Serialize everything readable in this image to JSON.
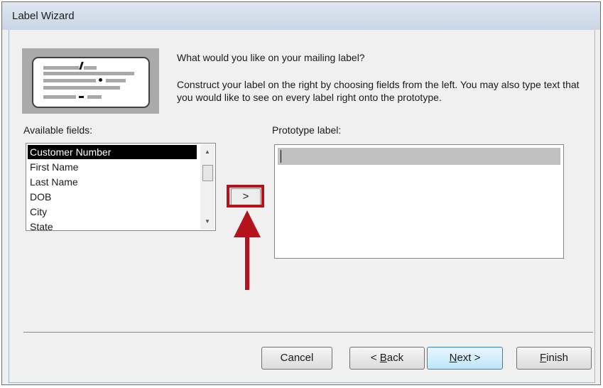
{
  "window": {
    "title": "Label Wizard"
  },
  "intro": {
    "question": "What would you like on your mailing label?",
    "instructions": "Construct your label on the right by choosing fields from the left. You may also type text that you would like to see on every label right onto the prototype."
  },
  "available_fields": {
    "label": "Available fields:",
    "items": [
      "Customer Number",
      "First Name",
      "Last Name",
      "DOB",
      "City",
      "State"
    ],
    "selected": "Customer Number"
  },
  "add_button": {
    "label": ">"
  },
  "prototype": {
    "label": "Prototype label:",
    "value": ""
  },
  "buttons": {
    "cancel": "Cancel",
    "back": {
      "accel": "<",
      "pre": " ",
      "key": "B",
      "rest": "ack"
    },
    "next": {
      "key": "N",
      "rest": "ext >"
    },
    "finish": {
      "key": "F",
      "rest": "inish"
    }
  },
  "colors": {
    "annotation": "#b5121b",
    "selection": "#000000"
  }
}
